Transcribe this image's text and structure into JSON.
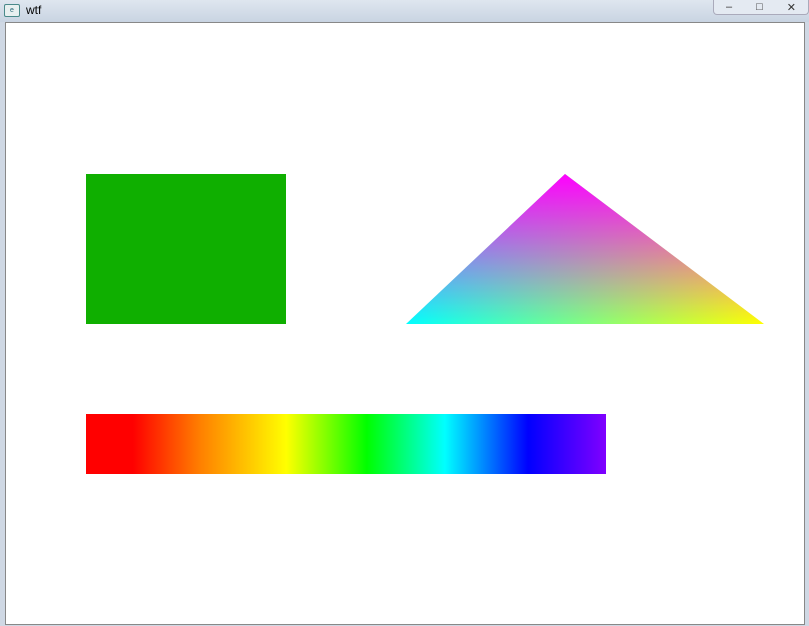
{
  "window": {
    "title": "wtf",
    "minimize": "–",
    "maximize": "□",
    "close": "✕"
  },
  "colors": {
    "rectangle": "#0faf00",
    "triangle_apex": "#ff00ff",
    "triangle_left": "#00ffff",
    "triangle_right": "#ffff00"
  }
}
